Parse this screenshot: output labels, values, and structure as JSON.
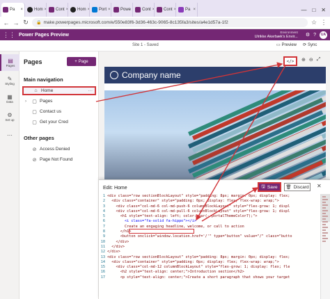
{
  "browser": {
    "tabs": [
      {
        "label": "Pa",
        "favicon": "power-pages",
        "active": true
      },
      {
        "label": "Hom",
        "favicon": "github"
      },
      {
        "label": "Cont",
        "favicon": "power-pages"
      },
      {
        "label": "Hom",
        "favicon": "github"
      },
      {
        "label": "Port",
        "favicon": "microsoft"
      },
      {
        "label": "Powe",
        "favicon": "power-pages"
      },
      {
        "label": "Cont",
        "favicon": "power-pages"
      },
      {
        "label": "Cont",
        "favicon": "power-pages"
      },
      {
        "label": "Pa",
        "favicon": "power-apps"
      }
    ],
    "url": "make.powerpages.microsoft.com/e/550e83f6-3d36-463c-9065-8c135fa3/sites/a4e1d57a-1f2"
  },
  "header": {
    "app_title": "Power Pages Preview",
    "env_label": "Environment",
    "env_value": "Ulrikke Akerbæk's Envir...",
    "avatar": "UA"
  },
  "cmdbar": {
    "site_status": "Site 1 - Saved",
    "preview": "Preview",
    "sync": "Sync"
  },
  "rail": [
    {
      "label": "Pages",
      "icon": "page-icon",
      "active": true
    },
    {
      "label": "Styling",
      "icon": "brush-icon"
    },
    {
      "label": "Data",
      "icon": "table-icon"
    },
    {
      "label": "Set up",
      "icon": "gear-icon"
    },
    {
      "label": "",
      "icon": "more-icon"
    }
  ],
  "pages_panel": {
    "title": "Pages",
    "add_button": "Page",
    "main_nav_heading": "Main navigation",
    "main_nav": [
      {
        "label": "Home",
        "chevron": false,
        "selected": true
      },
      {
        "label": "Pages",
        "chevron": true
      },
      {
        "label": "Contact us",
        "chevron": false
      },
      {
        "label": "Get your Cred",
        "chevron": false
      }
    ],
    "other_heading": "Other pages",
    "other_pages": [
      {
        "label": "Access Denied"
      },
      {
        "label": "Page Not Found"
      }
    ]
  },
  "site_preview": {
    "company_name": "Company name"
  },
  "toolbar": {
    "code_button": "</>",
    "zoom_in": "⊕",
    "zoom_out": "⊖",
    "expand": "⤢"
  },
  "editor": {
    "title": "Edit: Home",
    "save_label": "Save",
    "discard_label": "Discard",
    "lines": [
      {
        "n": "1",
        "text": "<div class=\"row sectionBlockLayout\" style=\"padding: 8px; margin: 0px; display: flex;"
      },
      {
        "n": "2",
        "text": "  <div class=\"container\" style=\"padding: 0px; display: flex; flex-wrap: wrap;\">"
      },
      {
        "n": "3",
        "text": "    <div class=\"col-md-6 col-md-push-6 columnBlockLayout\" style=\"flex-grow: 1; displ"
      },
      {
        "n": "4",
        "text": "    <div class=\"col-md-6 col-md-pull-6 columnBlockLayout\" style=\"flex-grow: 1; displ"
      },
      {
        "n": "5",
        "text": "      <h1 style=\"text-align: left; color: var(--portalThemeColor7);\">"
      },
      {
        "n": "6",
        "text": "        <i class=\"fa-solid fa-hippo\"></i>",
        "hl": true
      },
      {
        "n": "7",
        "text": "        Create an engaging headline, welcome, or call to action"
      },
      {
        "n": "8",
        "text": "      </h1>"
      },
      {
        "n": "9",
        "text": "      <button onclick=\"window.location.href='/'\" type=\"button\" value=\"/\" class=\"butto"
      },
      {
        "n": "10",
        "text": "    </div>"
      },
      {
        "n": "11",
        "text": "  </div>"
      },
      {
        "n": "12",
        "text": "</div>"
      },
      {
        "n": "13",
        "text": "<div class=\"row sectionBlockLayout\" style=\"padding: 8px; margin: 0px; display: flex;"
      },
      {
        "n": "14",
        "text": "  <div class=\"container\" style=\"padding: 0px; display: flex; flex-wrap: wrap;\">"
      },
      {
        "n": "15",
        "text": "    <div class=\"col-md-12 columnBlockLayout\" style=\"flex-grow: 1; display: flex; fle"
      },
      {
        "n": "16",
        "text": "      <h2 style=\"text-align: center;\">Introduction section</h2>"
      },
      {
        "n": "17",
        "text": "      <p style=\"text-align: center;\">Create a short paragraph that shows your target"
      }
    ]
  },
  "colors": {
    "brand": "#742774",
    "annotation": "#d13438",
    "site_header": "#2c3e6b"
  }
}
